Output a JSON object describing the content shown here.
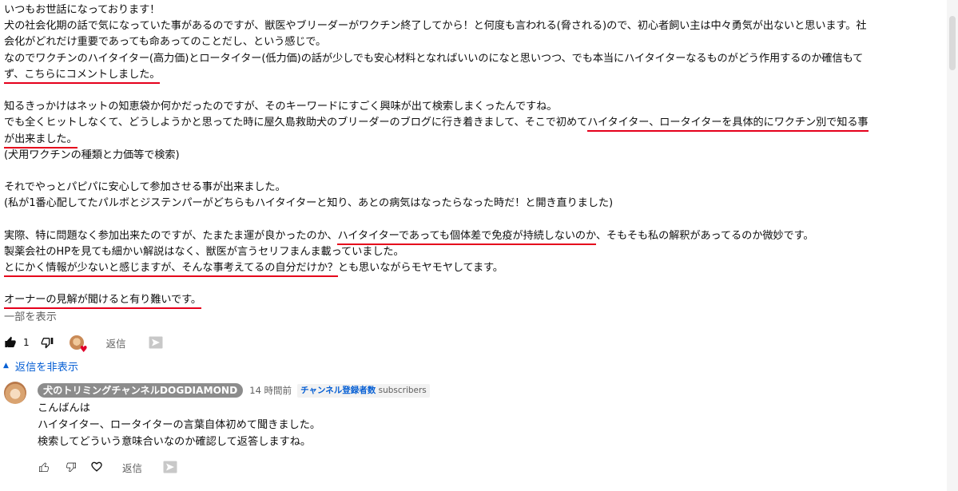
{
  "comment": {
    "lines": [
      [
        {
          "t": "いつもお世話になっております！"
        }
      ],
      [
        {
          "t": "犬の社会化期の話で気になっていた事があるのですが、獣医やブリーダーがワクチン終了してから！と何度も言われる(脅される)ので、初心者飼い主は中々勇気が出ないと思います。社"
        }
      ],
      [
        {
          "t": "会化がどれだけ重要であっても命あってのことだし、という感じで。"
        }
      ],
      [
        {
          "t": "なのでワクチンのハイタイター(高力価)とロータイター(低力価)の話が少しでも安心材料となればいいのになと思いつつ、でも本当にハイタイターなるものがどう作用するのか確信もて"
        }
      ],
      [
        {
          "t": "ず、こちらにコメントしました。",
          "u": true
        }
      ],
      [],
      [
        {
          "t": "知るきっかけはネットの知恵袋か何かだったのですが、そのキーワードにすごく興味が出て検索しまくったんですね。"
        }
      ],
      [
        {
          "t": "でも全くヒットしなくて、どうしようかと思ってた時に屋久島救助犬のブリーダーのブログに行き着きまして、そこで初めて"
        },
        {
          "t": "ハイタイター、ロータイターを具体的にワクチン別で知る事",
          "u": true
        }
      ],
      [
        {
          "t": "が出来ました。",
          "u": true
        }
      ],
      [
        {
          "t": "(犬用ワクチンの種類と力価等で検索)"
        }
      ],
      [],
      [
        {
          "t": "それでやっとパピパに安心して参加させる事が出来ました。"
        }
      ],
      [
        {
          "t": "(私が1番心配してたパルボとジステンパーがどちらもハイタイターと知り、あとの病気はなったらなった時だ！と開き直りました)"
        }
      ],
      [],
      [
        {
          "t": "実際、特に問題なく参加出来たのですが、たまたま運が良かったのか、"
        },
        {
          "t": "ハイタイターであっても個体差で免疫が持続しないのか",
          "u": true
        },
        {
          "t": "、そもそも私の解釈があってるのか微妙です。"
        }
      ],
      [
        {
          "t": "製薬会社のHPを見ても細かい解説はなく、獣医が言うセリフまんま載っていました。"
        }
      ],
      [
        {
          "t": "とにかく情報が少ないと感じますが、そんな事考えてるの自分だけか？",
          "u": true
        },
        {
          "t": "とも思いながらモヤモヤしてます。"
        }
      ],
      [],
      [
        {
          "t": "オーナーの見解が聞けると有り難いです。",
          "u": true
        }
      ]
    ],
    "show_less": "一部を表示",
    "like_count": "1",
    "reply_label": "返信"
  },
  "replies_toggle": "返信を非表示",
  "reply": {
    "author": "犬のトリミングチャンネルDOGDIAMOND",
    "time": "14 時間前",
    "badge_link": "チャンネル登録者数",
    "badge_suffix": "subscribers",
    "lines": [
      "こんばんは",
      "ハイタイター、ロータイターの言葉自体初めて聞きました。",
      "検索してどういう意味合いなのか確認して返答しますね。"
    ],
    "reply_label": "返信"
  },
  "icons": {
    "like": "thumbs-up-icon",
    "dislike": "thumbs-down-icon",
    "heart": "creator-heart-icon",
    "highlight": "highlight-flag-icon"
  },
  "colors": {
    "underline": "#e5001b",
    "link": "#065fd4",
    "secondary": "#606060",
    "author_chip": "#8c8c8c"
  }
}
